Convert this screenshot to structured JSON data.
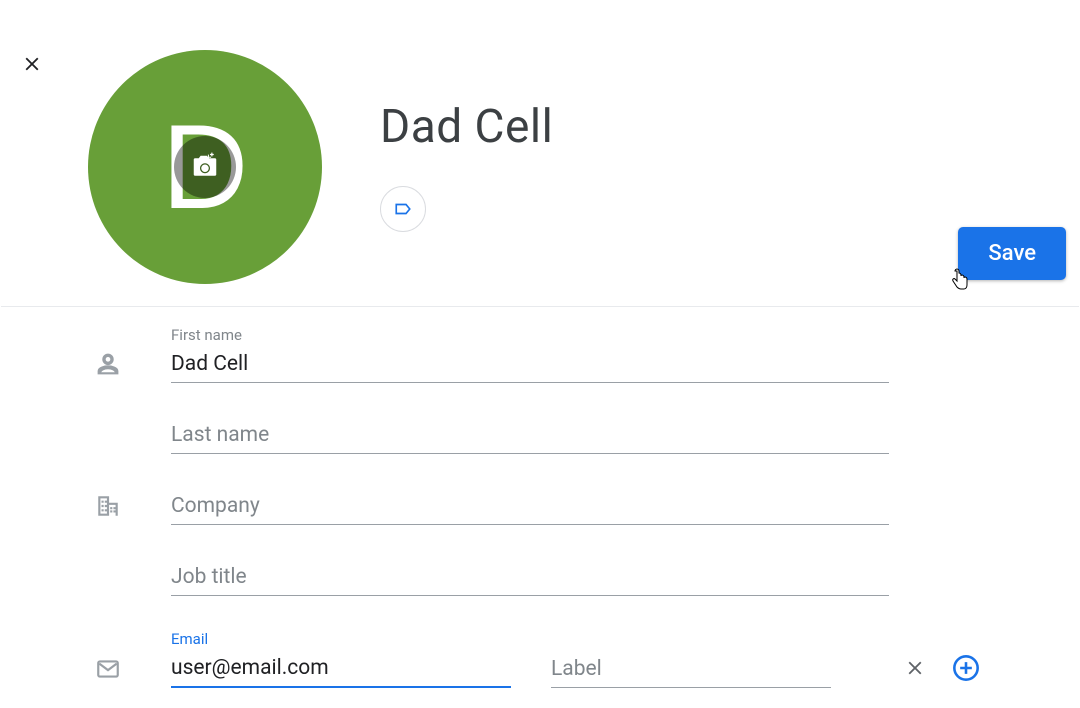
{
  "contact": {
    "display_name": "Dad Cell",
    "avatar_letter": "D",
    "avatar_color": "#689f38"
  },
  "actions": {
    "save_label": "Save"
  },
  "fields": {
    "first_name": {
      "label": "First name",
      "value": "Dad Cell",
      "placeholder": "First name"
    },
    "last_name": {
      "label": "Last name",
      "value": "",
      "placeholder": "Last name"
    },
    "company": {
      "label": "Company",
      "value": "",
      "placeholder": "Company"
    },
    "job_title": {
      "label": "Job title",
      "value": "",
      "placeholder": "Job title"
    },
    "email": {
      "label": "Email",
      "value": "user@email.com",
      "placeholder": "Email"
    },
    "email_label": {
      "label": "Label",
      "value": "",
      "placeholder": "Label"
    }
  },
  "icons": {
    "close": "close-icon",
    "camera": "camera-icon",
    "tag": "label-icon",
    "person": "person-icon",
    "building": "company-icon",
    "envelope": "email-icon",
    "clear": "clear-icon",
    "add": "add-icon"
  }
}
